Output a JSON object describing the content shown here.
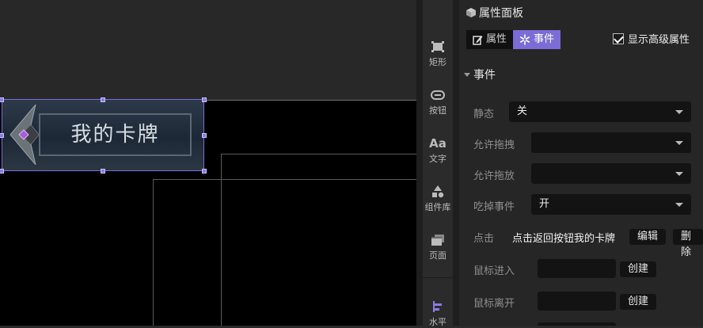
{
  "canvas": {
    "card_title": "我的卡牌"
  },
  "rail": {
    "tools": [
      {
        "label": "矩形",
        "icon": "rectangle-icon"
      },
      {
        "label": "按钮",
        "icon": "button-icon"
      },
      {
        "label": "文字",
        "icon": "text-icon"
      },
      {
        "label": "组件库",
        "icon": "component-library-icon"
      },
      {
        "label": "页面",
        "icon": "page-icon"
      },
      {
        "label": "水平",
        "icon": "align-horizontal-icon"
      }
    ],
    "text_icon_glyph": "Aa"
  },
  "panel": {
    "title": "属性面板",
    "tabs": [
      {
        "label": "属性",
        "active": false
      },
      {
        "label": "事件",
        "active": true
      }
    ],
    "show_advanced_label": "显示高级属性",
    "show_advanced_checked": true,
    "section_title": "事件",
    "fields": {
      "static_label": "静态",
      "static_value": "关",
      "allow_drag_label": "允许拖拽",
      "allow_drag_value": "",
      "allow_drop_label": "允许拖放",
      "allow_drop_value": "",
      "swallow_label": "吃掉事件",
      "swallow_value": "开",
      "click_label": "点击",
      "click_value": "点击返回按钮我的卡牌",
      "edit_button": "编辑",
      "delete_button": "删除",
      "mouse_enter_label": "鼠标进入",
      "mouse_leave_label": "鼠标离开",
      "create_button": "创建"
    }
  },
  "colors": {
    "accent": "#7b6cd6",
    "canvas_bg": "#000000",
    "panel_bg": "#262626"
  }
}
